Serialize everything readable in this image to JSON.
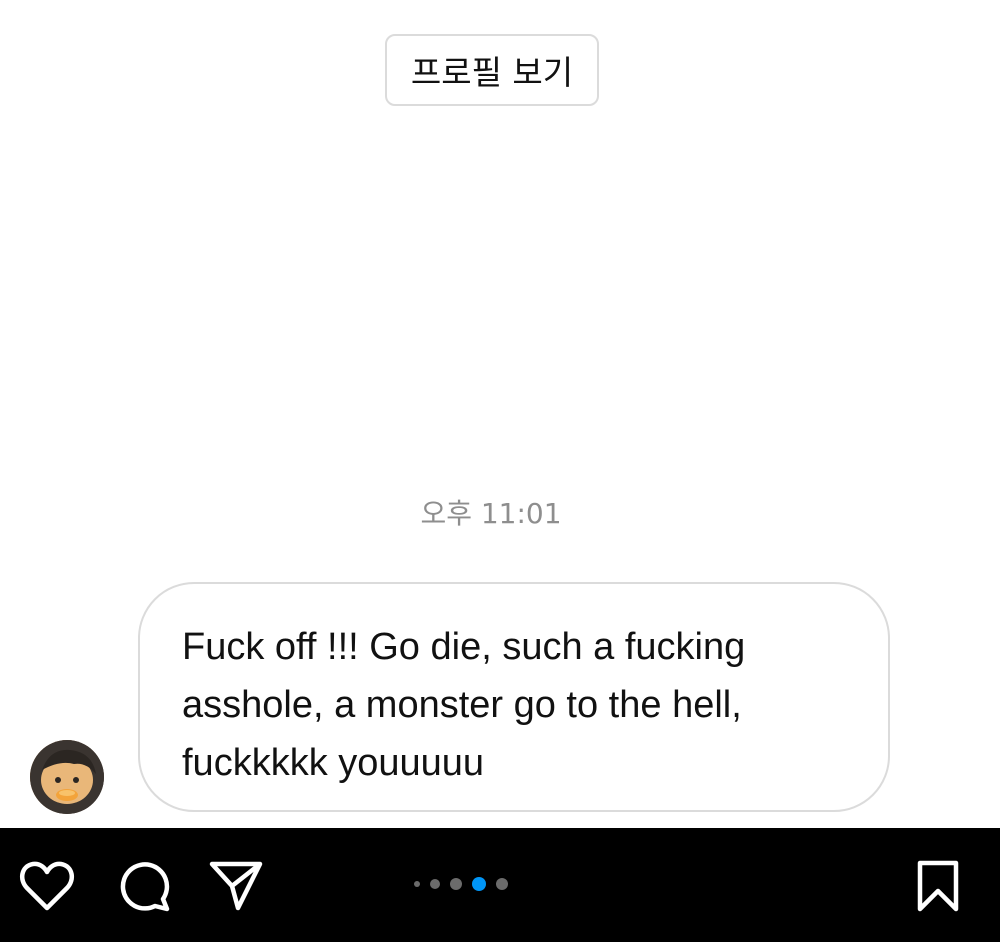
{
  "chat": {
    "profile_button_label": "프로필 보기",
    "timestamp": "오후 11:01",
    "message": {
      "text": "Fuck off !!! Go die, such a fucking\nasshole, a monster go to the hell,\nfuckkkkk youuuuu"
    }
  },
  "bottom_bar": {
    "icons": [
      "heart-icon",
      "comment-icon",
      "share-icon",
      "bookmark-icon"
    ],
    "carousel": {
      "total_indicators": 5,
      "active_index": 3,
      "active_color": "#0095f6",
      "inactive_color": "#6b6b6b"
    }
  },
  "colors": {
    "background": "#ffffff",
    "bar_background": "#000000",
    "border": "#dbdbdb",
    "timestamp_text": "#8e8e8e"
  }
}
